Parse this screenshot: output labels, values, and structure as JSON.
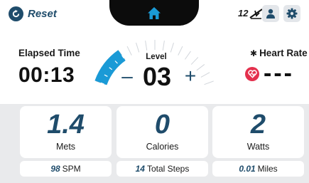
{
  "header": {
    "reset_label": "Reset",
    "incline_value": "12",
    "icons": {
      "reset": "reset-icon",
      "home": "home-icon",
      "incline": "incline-icon",
      "profile": "user-icon",
      "settings": "gear-icon"
    }
  },
  "workout": {
    "elapsed_label": "Elapsed Time",
    "elapsed_value": "00:13",
    "level_label": "Level",
    "level_value": "03",
    "level_minus": "–",
    "level_plus": "+",
    "heart_rate_label": "Heart Rate",
    "heart_rate_value": "---",
    "level_progress": 0.25
  },
  "stats": [
    {
      "value": "1.4",
      "label": "Mets"
    },
    {
      "value": "0",
      "label": "Calories"
    },
    {
      "value": "2",
      "label": "Watts"
    }
  ],
  "pills": [
    {
      "value": "98",
      "label": "SPM"
    },
    {
      "value": "14",
      "label": "Total Steps"
    },
    {
      "value": "0.01",
      "label": "Miles"
    }
  ],
  "colors": {
    "accent": "#1a9ad6",
    "navy": "#1f4c6b",
    "heart": "#e4304d",
    "background": "#e9eaec"
  }
}
